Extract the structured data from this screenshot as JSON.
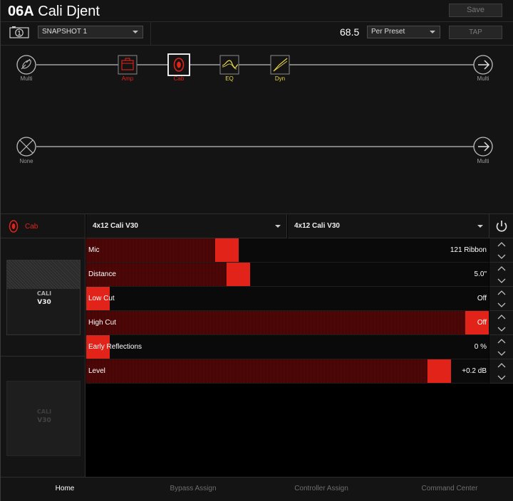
{
  "header": {
    "preset_number": "06A",
    "preset_name": "Cali Djent",
    "save_label": "Save",
    "snapshot_value": "SNAPSHOT 1",
    "tempo_value": "68.5",
    "tempo_mode": "Per Preset",
    "tap_label": "TAP",
    "snapshot_icon_digit": "1"
  },
  "signal_path": {
    "path1": {
      "input": {
        "label": "Multi",
        "icon": "guitar-input-icon"
      },
      "blocks": [
        {
          "label": "Amp",
          "icon": "amp-icon",
          "color": "#e2231a"
        },
        {
          "label": "Cab",
          "icon": "cab-speaker-icon",
          "color": "#e2231a",
          "selected": true
        },
        {
          "label": "EQ",
          "icon": "eq-icon",
          "color": "#e8d84a"
        },
        {
          "label": "Dyn",
          "icon": "dynamics-icon",
          "color": "#e8d84a"
        }
      ],
      "output": {
        "label": "Multi",
        "icon": "output-arrow-icon"
      }
    },
    "path2": {
      "input": {
        "label": "None",
        "icon": "none-x-icon"
      },
      "output": {
        "label": "Multi",
        "icon": "output-arrow-icon"
      }
    }
  },
  "editor": {
    "selected_block_label": "Cab",
    "model_1": "4x12 Cali V30",
    "model_2": "4x12 Cali V30",
    "cab_images": [
      {
        "logo_top": "CALI",
        "logo_bottom": "V30",
        "active": true
      },
      {
        "logo_top": "CALI",
        "logo_bottom": "V30",
        "active": false
      }
    ],
    "params": [
      {
        "name": "Mic",
        "value": "121 Ribbon",
        "level": 0.34
      },
      {
        "name": "Distance",
        "value": "5.0\"",
        "level": 0.37
      },
      {
        "name": "Low Cut",
        "value": "Off",
        "level": 0.0
      },
      {
        "name": "High Cut",
        "value": "Off",
        "level": 1.0
      },
      {
        "name": "Early Reflections",
        "value": "0 %",
        "level": 0.0
      },
      {
        "name": "Level",
        "value": "+0.2 dB",
        "level": 0.9
      }
    ]
  },
  "tabs": [
    {
      "label": "Home",
      "active": true
    },
    {
      "label": "Bypass Assign",
      "active": false
    },
    {
      "label": "Controller Assign",
      "active": false
    },
    {
      "label": "Command Center",
      "active": false
    }
  ],
  "colors": {
    "accent_red": "#e2231a",
    "accent_yellow": "#e8d84a",
    "background": "#141414"
  }
}
